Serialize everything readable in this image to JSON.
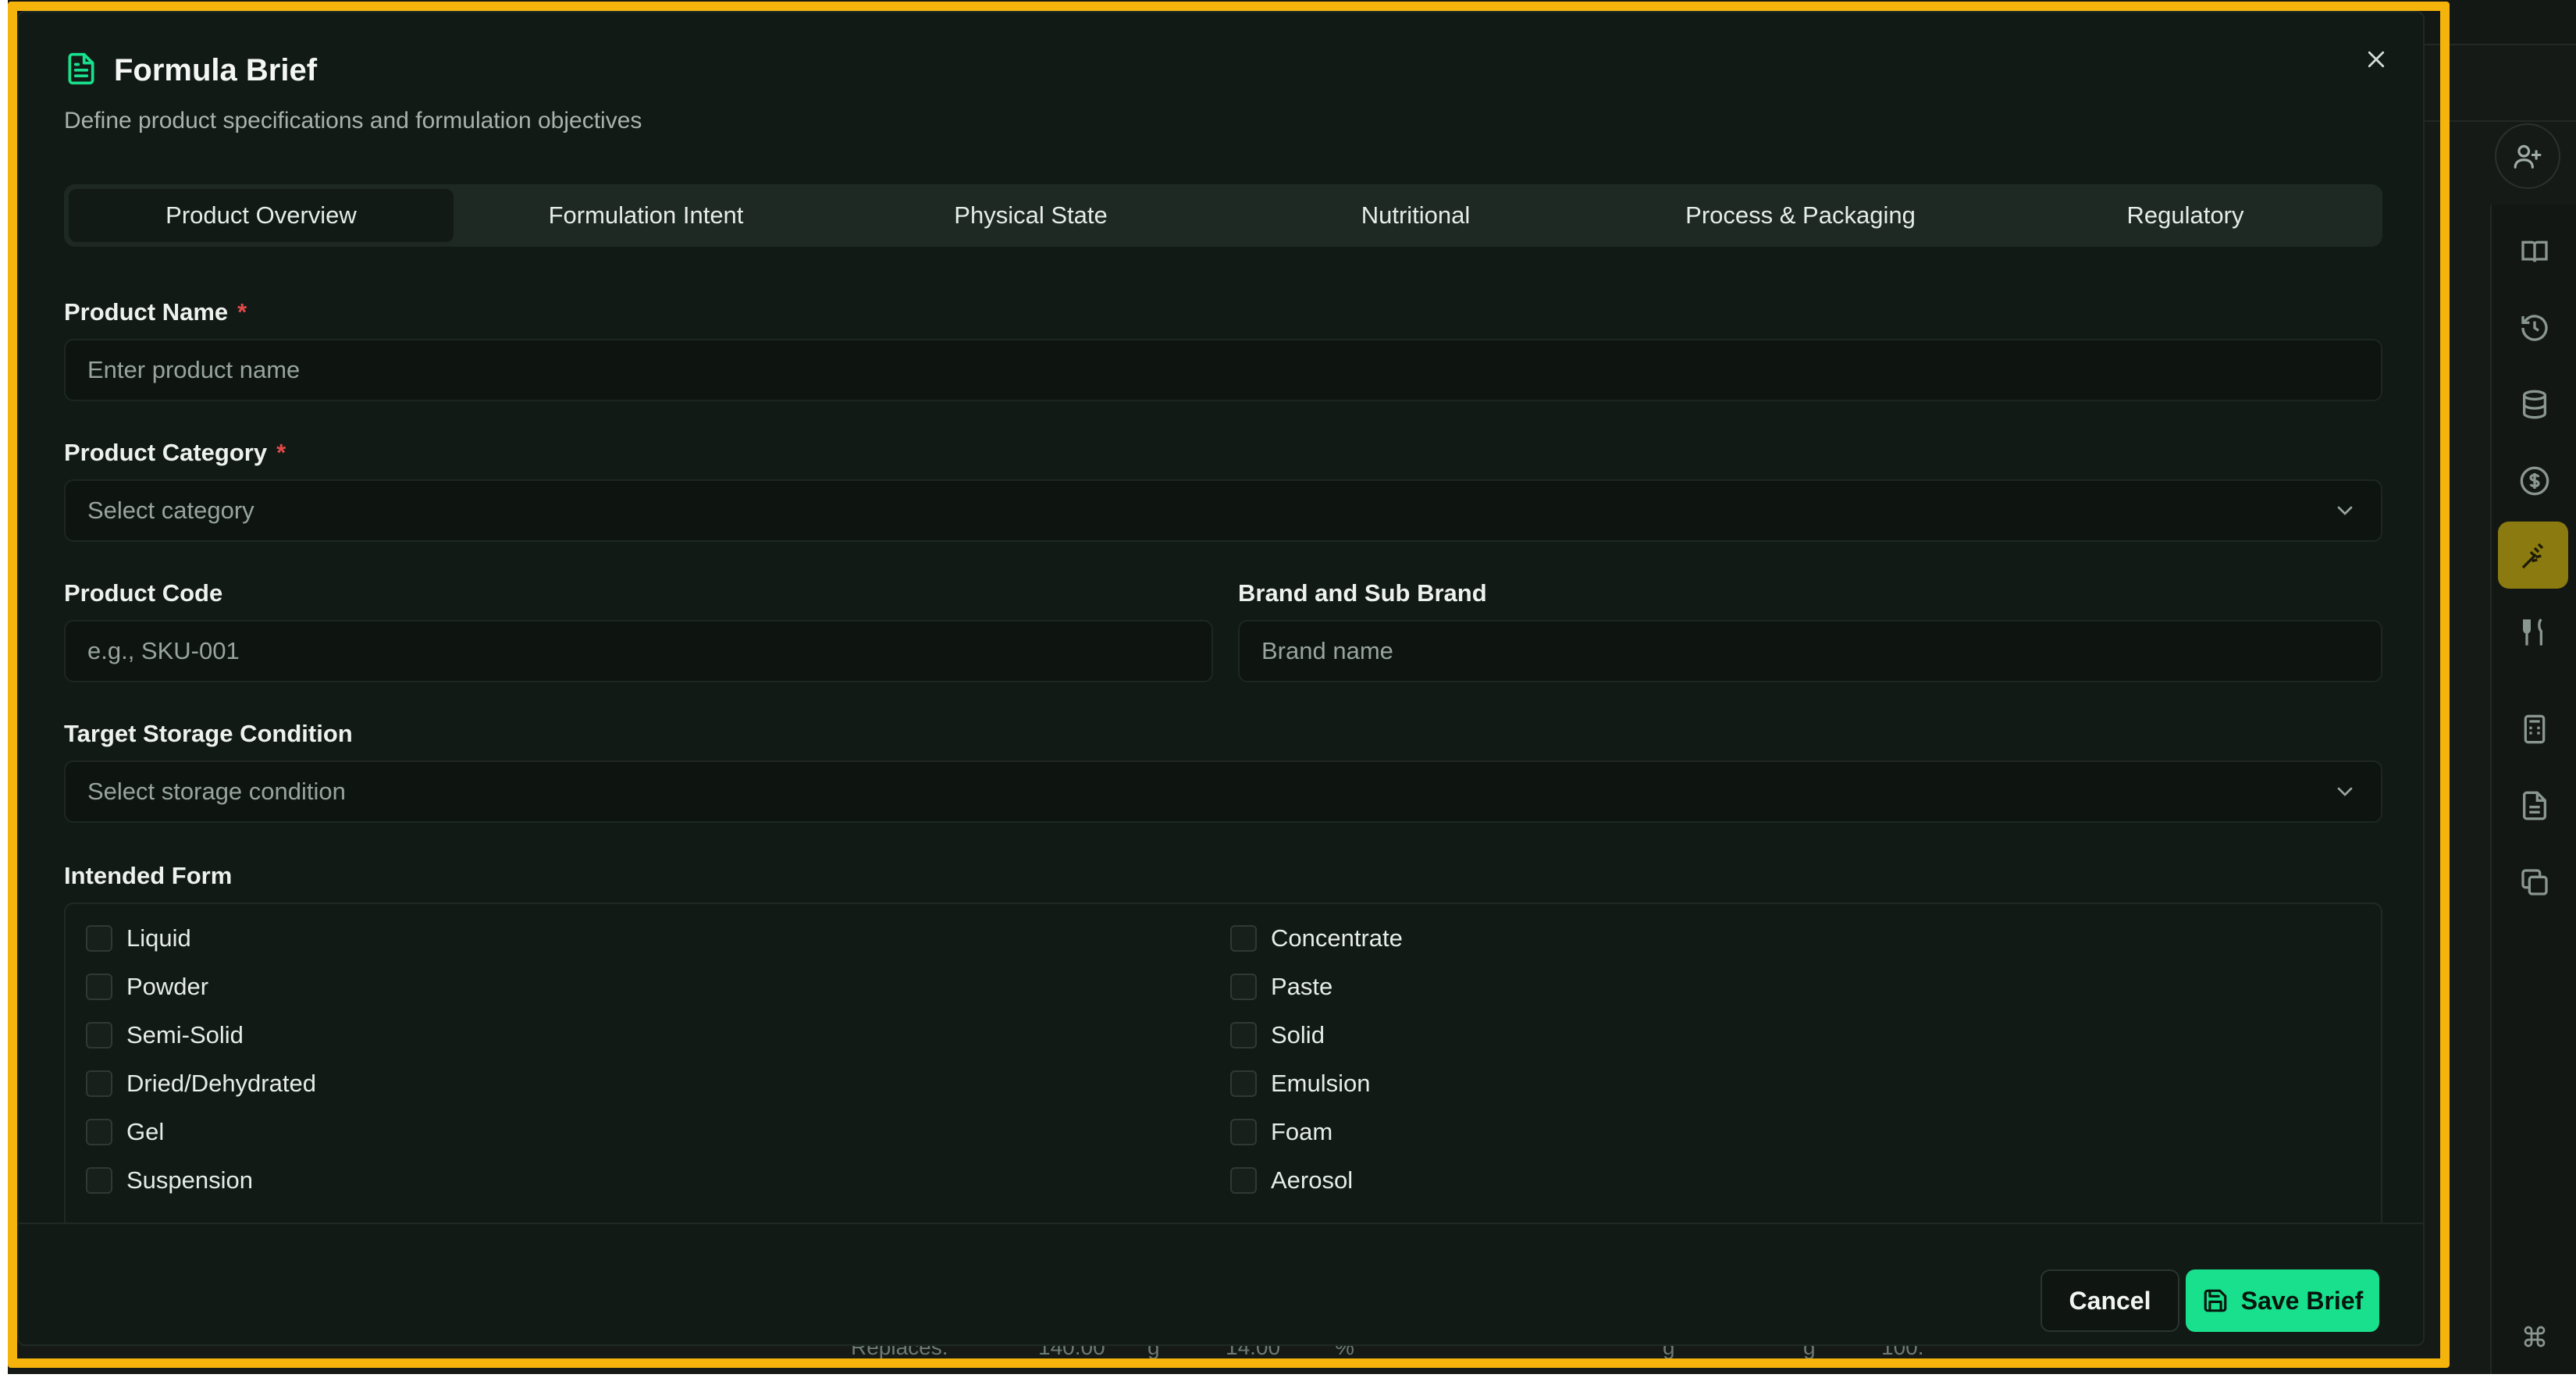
{
  "modal": {
    "title": "Formula Brief",
    "subtitle": "Define product specifications and formulation objectives",
    "icon": "document-icon",
    "accent_color": "#19e08c"
  },
  "tabs": [
    {
      "label": "Product Overview",
      "active": true
    },
    {
      "label": "Formulation Intent",
      "active": false
    },
    {
      "label": "Physical State",
      "active": false
    },
    {
      "label": "Nutritional",
      "active": false
    },
    {
      "label": "Process & Packaging",
      "active": false
    },
    {
      "label": "Regulatory",
      "active": false
    }
  ],
  "fields": {
    "product_name": {
      "label": "Product Name",
      "required_mark": "*",
      "placeholder": "Enter product name",
      "value": ""
    },
    "product_category": {
      "label": "Product Category",
      "required_mark": "*",
      "placeholder": "Select category"
    },
    "product_code": {
      "label": "Product Code",
      "placeholder": "e.g., SKU-001",
      "value": ""
    },
    "brand": {
      "label": "Brand and Sub Brand",
      "placeholder": "Brand name",
      "value": ""
    },
    "storage": {
      "label": "Target Storage Condition",
      "placeholder": "Select storage condition"
    }
  },
  "intended_form": {
    "label": "Intended Form",
    "left": [
      "Liquid",
      "Powder",
      "Semi-Solid",
      "Dried/Dehydrated",
      "Gel",
      "Suspension"
    ],
    "right": [
      "Concentrate",
      "Paste",
      "Solid",
      "Emulsion",
      "Foam",
      "Aerosol"
    ]
  },
  "footer": {
    "cancel_label": "Cancel",
    "save_label": "Save Brief"
  },
  "background": {
    "row_texts": [
      "Replaces:",
      "140.00",
      "g",
      "14.00",
      "%",
      "g",
      "g",
      "100."
    ]
  },
  "colors": {
    "highlight_border": "#f5b40b",
    "required": "#e24a4a",
    "rail_active": "#8a7a10"
  }
}
